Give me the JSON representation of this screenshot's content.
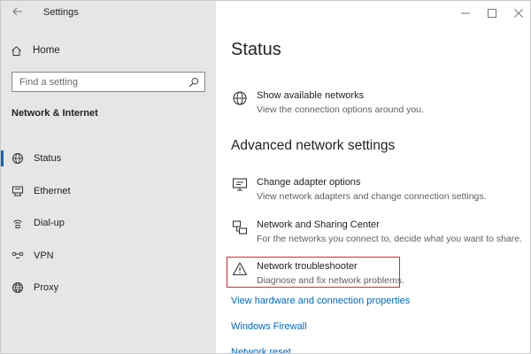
{
  "window": {
    "title": "Settings"
  },
  "sidebar": {
    "home_label": "Home",
    "search": {
      "placeholder": "Find a setting"
    },
    "section_title": "Network & Internet",
    "items": [
      {
        "label": "Status",
        "icon": "globe-network-icon",
        "active": true
      },
      {
        "label": "Ethernet",
        "icon": "ethernet-icon",
        "active": false
      },
      {
        "label": "Dial-up",
        "icon": "dial-up-icon",
        "active": false
      },
      {
        "label": "VPN",
        "icon": "vpn-icon",
        "active": false
      },
      {
        "label": "Proxy",
        "icon": "proxy-globe-icon",
        "active": false
      }
    ]
  },
  "main": {
    "title": "Status",
    "show_networks": {
      "title": "Show available networks",
      "desc": "View the connection options around you."
    },
    "advanced_title": "Advanced network settings",
    "options": [
      {
        "title": "Change adapter options",
        "desc": "View network adapters and change connection settings."
      },
      {
        "title": "Network and Sharing Center",
        "desc": "For the networks you connect to, decide what you want to share."
      },
      {
        "title": "Network troubleshooter",
        "desc": "Diagnose and fix network problems."
      }
    ],
    "links": {
      "hardware": "View hardware and connection properties",
      "firewall": "Windows Firewall",
      "reset": "Network reset"
    }
  },
  "colors": {
    "accent": "#0067c0",
    "highlight_border": "#e0242a",
    "sidebar_bg": "#e6e6e6"
  }
}
